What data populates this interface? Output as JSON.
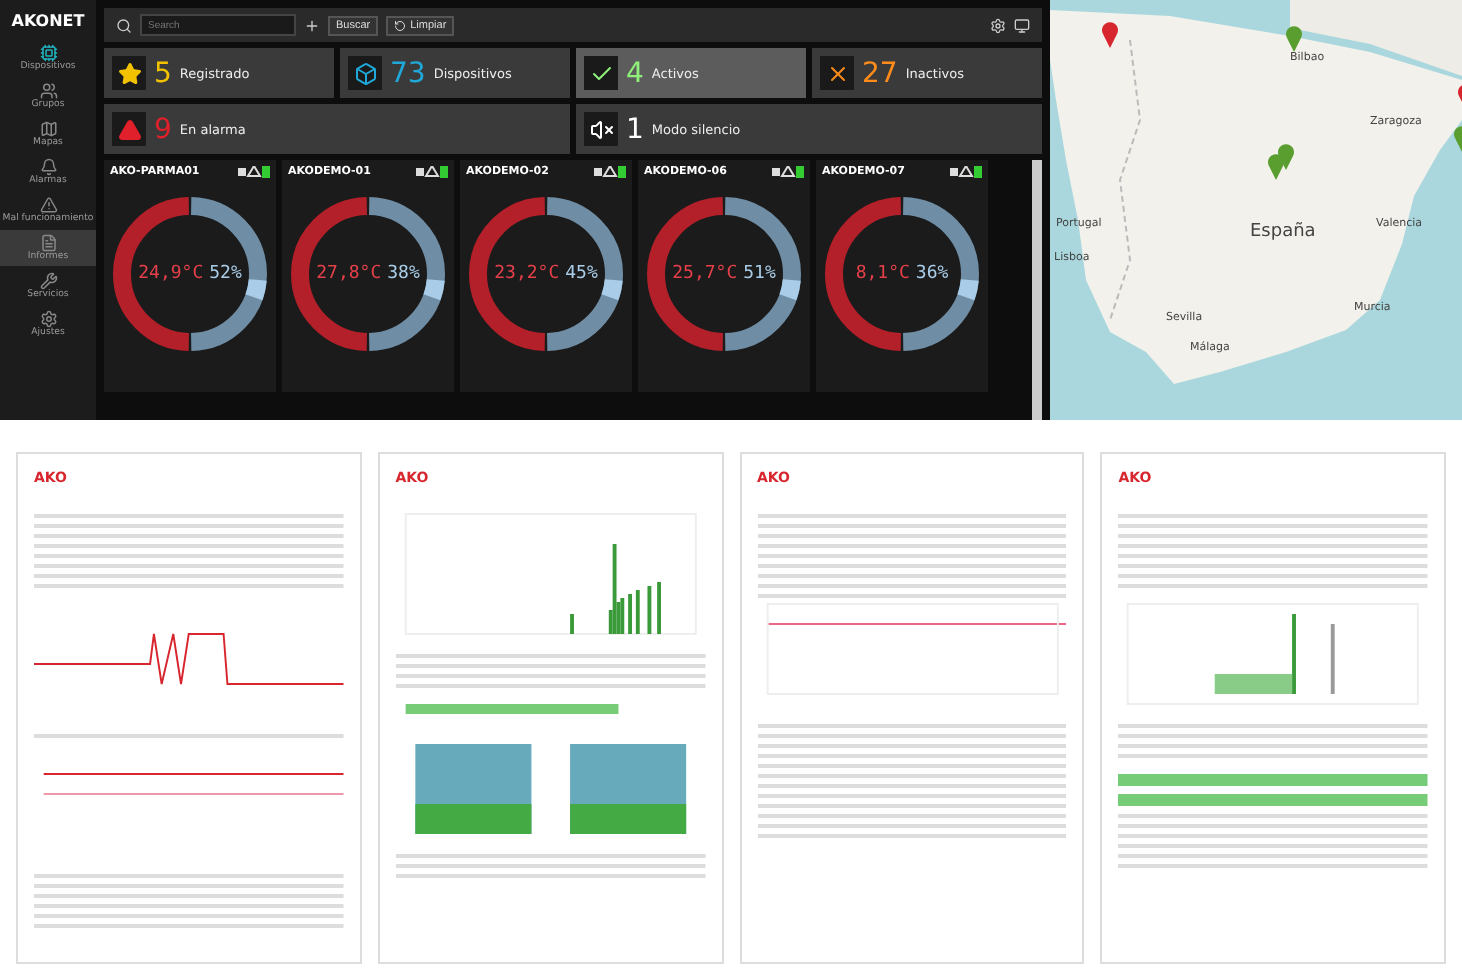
{
  "sidebar": {
    "logo": "AKONET",
    "items": [
      {
        "label": "Dispositivos",
        "selected": false
      },
      {
        "label": "Grupos",
        "selected": false
      },
      {
        "label": "Mapas",
        "selected": false
      },
      {
        "label": "Alarmas",
        "selected": false
      },
      {
        "label": "Mal funcionamiento",
        "selected": false
      },
      {
        "label": "Informes",
        "selected": true
      },
      {
        "label": "Servicios",
        "selected": false
      },
      {
        "label": "Ajustes",
        "selected": false
      }
    ]
  },
  "toolbar": {
    "search_placeholder": "Search",
    "search_button": "Buscar",
    "clear_button": "Limpiar"
  },
  "stats": [
    {
      "kind": "registered",
      "count": "5",
      "label": "Registrado",
      "selected": false
    },
    {
      "kind": "devices",
      "count": "73",
      "label": "Dispositivos",
      "selected": false
    },
    {
      "kind": "active",
      "count": "4",
      "label": "Activos",
      "selected": true
    },
    {
      "kind": "inactive",
      "count": "27",
      "label": "Inactivos",
      "selected": false
    },
    {
      "kind": "alarm",
      "count": "9",
      "label": "En alarma",
      "selected": false
    },
    {
      "kind": "silent",
      "count": "1",
      "label": "Modo silencio",
      "selected": false
    }
  ],
  "devices": [
    {
      "name": "AKO-PARMA01",
      "temperature": "24,9°C",
      "humidity": "52%"
    },
    {
      "name": "AKODEMO-01",
      "temperature": "27,8°C",
      "humidity": "38%"
    },
    {
      "name": "AKODEMO-02",
      "temperature": "23,2°C",
      "humidity": "45%"
    },
    {
      "name": "AKODEMO-06",
      "temperature": "25,7°C",
      "humidity": "51%"
    },
    {
      "name": "AKODEMO-07",
      "temperature": "8,1°C",
      "humidity": "36%"
    }
  ],
  "map": {
    "labels": [
      "Bilbao",
      "Zaragoza",
      "Portugal",
      "España",
      "Valencia",
      "Lisboa",
      "Sevilla",
      "Murcia",
      "Málaga"
    ],
    "pins": [
      {
        "color": "#d8262f"
      },
      {
        "color": "#5a9e2f"
      },
      {
        "color": "#5a9e2f"
      },
      {
        "color": "#5a9e2f"
      },
      {
        "color": "#d8262f"
      },
      {
        "color": "#5a9e2f"
      }
    ]
  },
  "reports": [
    {
      "logo": "AKO",
      "kind": "lines"
    },
    {
      "logo": "AKO",
      "kind": "bars"
    },
    {
      "logo": "AKO",
      "kind": "table"
    },
    {
      "logo": "AKO",
      "kind": "grid"
    }
  ]
}
